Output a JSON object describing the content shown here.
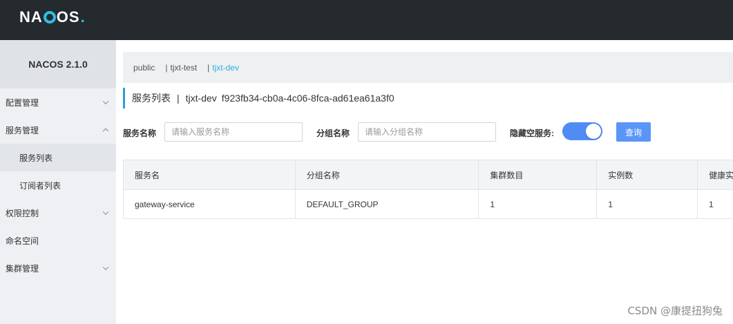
{
  "header": {
    "logo_text_left": "NA",
    "logo_text_right": "OS",
    "logo_dot": ".",
    "accent": "#2bc0e4"
  },
  "sidebar": {
    "version": "NACOS 2.1.0",
    "menu": [
      {
        "label": "配置管理",
        "icon": "chevron-down-icon"
      },
      {
        "label": "服务管理",
        "icon": "chevron-up-icon"
      },
      {
        "label": "服务列表"
      },
      {
        "label": "订阅者列表"
      },
      {
        "label": "权限控制",
        "icon": "chevron-down-icon"
      },
      {
        "label": "命名空间"
      },
      {
        "label": "集群管理",
        "icon": "chevron-down-icon"
      }
    ]
  },
  "namespaces": [
    "public",
    "tjxt-test",
    "tjxt-dev"
  ],
  "page": {
    "title": "服务列表",
    "separator": "|",
    "namespace_name": "tjxt-dev",
    "namespace_id": "f923fb34-cb0a-4c06-8fca-ad61ea61a3f0"
  },
  "search": {
    "service_label": "服务名称",
    "service_placeholder": "请输入服务名称",
    "group_label": "分组名称",
    "group_placeholder": "请输入分组名称",
    "hide_empty_label": "隐藏空服务:",
    "query_button": "查询",
    "toggle_color": "#4f8cf5"
  },
  "table": {
    "headers": [
      "服务名",
      "分组名称",
      "集群数目",
      "实例数",
      "健康实"
    ],
    "rows": [
      [
        "gateway-service",
        "DEFAULT_GROUP",
        "1",
        "1",
        "1"
      ]
    ]
  },
  "watermark": "CSDN @康提扭狗兔"
}
